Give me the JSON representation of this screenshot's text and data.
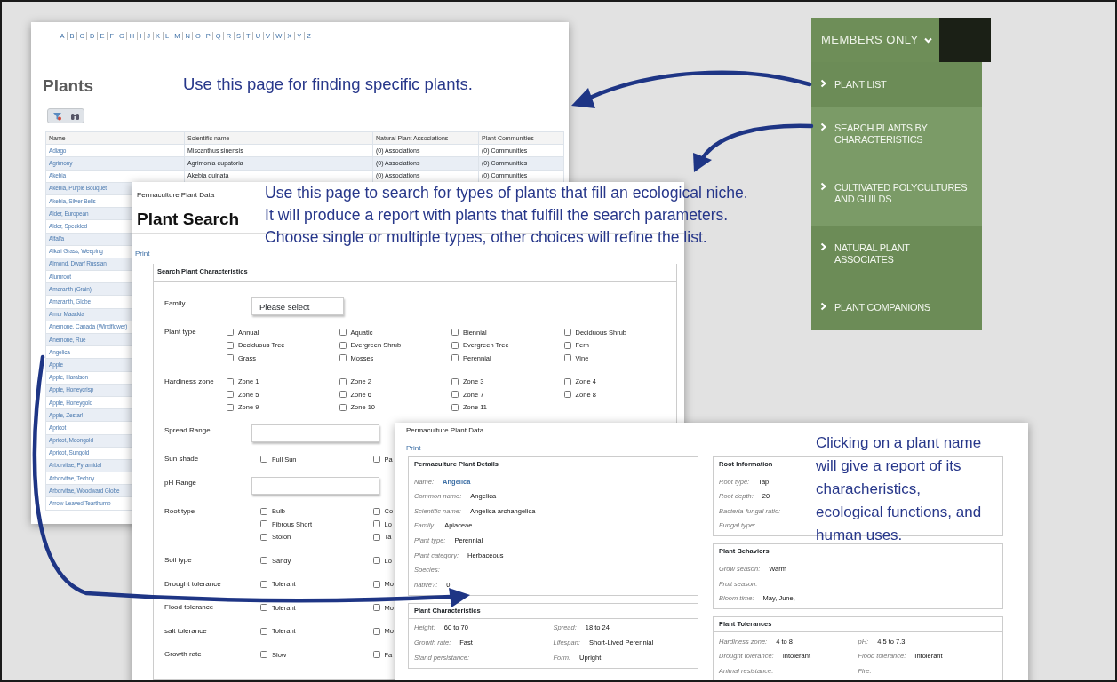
{
  "plants_page": {
    "alphabet": [
      "A",
      "B",
      "C",
      "D",
      "E",
      "F",
      "G",
      "H",
      "I",
      "J",
      "K",
      "L",
      "M",
      "N",
      "O",
      "P",
      "Q",
      "R",
      "S",
      "T",
      "U",
      "V",
      "W",
      "X",
      "Y",
      "Z"
    ],
    "title": "Plants",
    "annotation": "Use this page for finding specific plants.",
    "table": {
      "columns": [
        "Name",
        "Scientific name",
        "Natural Plant Associations",
        "Plant Communities"
      ],
      "rows": [
        {
          "cells": [
            "Adiago",
            "Miscanthus sinensis",
            "(0) Associations",
            "(0) Communities"
          ]
        },
        {
          "cells": [
            "Agrimony",
            "Agrimonia eupatoria",
            "(0) Associations",
            "(0) Communities"
          ]
        },
        {
          "cells": [
            "Akebia",
            "Akebia quinata",
            "(0) Associations",
            "(0) Communities"
          ]
        },
        {
          "cells": [
            "Akebia, Purple Bouquet"
          ]
        },
        {
          "cells": [
            "Akebia, Silver Bells"
          ]
        },
        {
          "cells": [
            "Alder, European"
          ]
        },
        {
          "cells": [
            "Alder, Speckled"
          ]
        },
        {
          "cells": [
            "Alfalfa"
          ]
        },
        {
          "cells": [
            "Alkali Grass, Weeping"
          ]
        },
        {
          "cells": [
            "Almond, Dwarf Russian"
          ]
        },
        {
          "cells": [
            "Alumroot"
          ]
        },
        {
          "cells": [
            "Amaranth (Grain)"
          ]
        },
        {
          "cells": [
            "Amaranth, Globe"
          ]
        },
        {
          "cells": [
            "Amur Maackia"
          ]
        },
        {
          "cells": [
            "Anemone, Canada (Windflower)"
          ]
        },
        {
          "cells": [
            "Anemone, Rue"
          ]
        },
        {
          "cells": [
            "Angelica"
          ]
        },
        {
          "cells": [
            "Apple"
          ]
        },
        {
          "cells": [
            "Apple, Haralson"
          ]
        },
        {
          "cells": [
            "Apple, Honeycrisp"
          ]
        },
        {
          "cells": [
            "Apple, Honeygold"
          ]
        },
        {
          "cells": [
            "Apple, Zestar!"
          ]
        },
        {
          "cells": [
            "Apricot"
          ]
        },
        {
          "cells": [
            "Apricot, Moongold"
          ]
        },
        {
          "cells": [
            "Apricot, Sungold"
          ]
        },
        {
          "cells": [
            "Arborvitae, Pyramidal"
          ]
        },
        {
          "cells": [
            "Arborvitae, Techny"
          ]
        },
        {
          "cells": [
            "Arborvitae, Woodward Globe"
          ]
        },
        {
          "cells": [
            "Arrow-Leaved Tearthumb"
          ]
        }
      ]
    }
  },
  "search_page": {
    "site": "Permaculture Plant Data",
    "title": "Plant Search",
    "print": "Print",
    "annotation": [
      "Use this page to search for types of plants that fill an ecological niche.",
      "It will produce a report with plants that fulfill the search parameters.",
      "Choose single or multiple types, other choices will refine the list."
    ],
    "section": "Search Plant Characteristics",
    "fields": [
      {
        "label": "Family",
        "kind": "select",
        "value": "Please select"
      },
      {
        "label": "Plant type",
        "kind": "checkboxes",
        "columns": [
          [
            {
              "label": "Annual",
              "checked": false
            },
            {
              "label": "Deciduous Tree",
              "checked": false
            },
            {
              "label": "Grass",
              "checked": false
            }
          ],
          [
            {
              "label": "Aquatic",
              "checked": false
            },
            {
              "label": "Evergreen Shrub",
              "checked": false
            },
            {
              "label": "Mosses",
              "checked": false
            }
          ],
          [
            {
              "label": "Biennial",
              "checked": false
            },
            {
              "label": "Evergreen Tree",
              "checked": false
            },
            {
              "label": "Perennial",
              "checked": false
            }
          ],
          [
            {
              "label": "Deciduous Shrub",
              "checked": false
            },
            {
              "label": "Fern",
              "checked": false
            },
            {
              "label": "Vine",
              "checked": false
            }
          ]
        ]
      },
      {
        "label": "Hardiness zone",
        "kind": "checkboxes",
        "columns": [
          [
            {
              "label": "Zone 1",
              "checked": false
            },
            {
              "label": "Zone 5",
              "checked": false
            },
            {
              "label": "Zone 9",
              "checked": false
            }
          ],
          [
            {
              "label": "Zone 2",
              "checked": false
            },
            {
              "label": "Zone 6",
              "checked": false
            },
            {
              "label": "Zone 10",
              "checked": false
            }
          ],
          [
            {
              "label": "Zone 3",
              "checked": false
            },
            {
              "label": "Zone 7",
              "checked": false
            },
            {
              "label": "Zone 11",
              "checked": false
            }
          ],
          [
            {
              "label": "Zone 4",
              "checked": false
            },
            {
              "label": "Zone 8",
              "checked": false
            }
          ]
        ]
      },
      {
        "label": "Spread Range",
        "kind": "text"
      },
      {
        "label": "Sun shade",
        "kind": "checkboxes",
        "columns": [
          [
            {
              "label": "Full Sun",
              "checked": false
            }
          ],
          [
            {
              "label": "Pa",
              "checked": false
            }
          ]
        ]
      },
      {
        "label": "pH Range",
        "kind": "text"
      },
      {
        "label": "Root type",
        "kind": "checkboxes",
        "columns": [
          [
            {
              "label": "Bulb",
              "checked": false
            },
            {
              "label": "Fibrous Short",
              "checked": false
            },
            {
              "label": "Stolon",
              "checked": false
            }
          ],
          [
            {
              "label": "Co",
              "checked": false
            },
            {
              "label": "Lo",
              "checked": false
            },
            {
              "label": "Ta",
              "checked": false
            }
          ]
        ]
      },
      {
        "label": "Soil type",
        "kind": "checkboxes",
        "columns": [
          [
            {
              "label": "Sandy",
              "checked": false
            }
          ],
          [
            {
              "label": "Lo",
              "checked": false
            }
          ]
        ]
      },
      {
        "label": "Drought tolerance",
        "kind": "checkboxes",
        "columns": [
          [
            {
              "label": "Tolerant",
              "checked": false
            }
          ],
          [
            {
              "label": "Mo",
              "checked": false
            }
          ]
        ]
      },
      {
        "label": "Flood tolerance",
        "kind": "checkboxes",
        "columns": [
          [
            {
              "label": "Tolerant",
              "checked": false
            }
          ],
          [
            {
              "label": "Mo",
              "checked": false
            }
          ]
        ]
      },
      {
        "label": "salt tolerance",
        "kind": "checkboxes",
        "columns": [
          [
            {
              "label": "Tolerant",
              "checked": false
            }
          ],
          [
            {
              "label": "Mo",
              "checked": false
            }
          ]
        ]
      },
      {
        "label": "Growth rate",
        "kind": "checkboxes",
        "columns": [
          [
            {
              "label": "Slow",
              "checked": false
            }
          ],
          [
            {
              "label": "Fa",
              "checked": false
            }
          ]
        ]
      }
    ]
  },
  "details_page": {
    "site": "Permaculture Plant Data",
    "print": "Print",
    "annotation": "Clicking on a plant name will give a report of its characheristics, ecological functions, and human uses.",
    "left_sections": [
      {
        "title": "Permaculture Plant Details",
        "rows": [
          [
            {
              "label": "Name:",
              "value": "Angelica",
              "kind": "link"
            }
          ],
          [
            {
              "label": "Common name:",
              "value": "Angelica",
              "kind": "text"
            }
          ],
          [
            {
              "label": "Scientific name:",
              "value": "Angelica archangelica",
              "kind": "text"
            }
          ],
          [
            {
              "label": "Family:",
              "value": "Apiaceae",
              "kind": "text"
            }
          ],
          [
            {
              "label": "Plant type:",
              "value": "Perennial",
              "kind": "text"
            }
          ],
          [
            {
              "label": "Plant category:",
              "value": "Herbaceous",
              "kind": "text"
            }
          ],
          [
            {
              "label": "Species:"
            }
          ],
          [
            {
              "label": "native?:",
              "value": "0",
              "kind": "text"
            }
          ]
        ]
      },
      {
        "title": "Plant Characteristics",
        "rows": [
          [
            {
              "label": "Height:",
              "value": "60 to 70",
              "kind": "text"
            },
            {
              "label": "Spread:",
              "value": "18 to 24",
              "kind": "text"
            }
          ],
          [
            {
              "label": "Growth rate:",
              "value": "Fast",
              "kind": "text"
            },
            {
              "label": "Lifespan:",
              "value": "Short-Lived Perennial",
              "kind": "text"
            }
          ],
          [
            {
              "label": "Stand persistance:"
            },
            {
              "label": "Form:",
              "value": "Upright",
              "kind": "text"
            }
          ]
        ]
      }
    ],
    "right_sections": [
      {
        "title": "Root Information",
        "rows": [
          [
            {
              "label": "Root type:",
              "value": "Tap",
              "kind": "text"
            }
          ],
          [
            {
              "label": "Root depth:",
              "value": "20",
              "kind": "text"
            }
          ],
          [
            {
              "label": "Bacteria-fungal ratio:"
            }
          ],
          [
            {
              "label": "Fungal type:"
            }
          ]
        ]
      },
      {
        "title": "Plant Behaviors",
        "rows": [
          [
            {
              "label": "Grow season:",
              "value": "Warm",
              "kind": "text"
            }
          ],
          [
            {
              "label": "Fruit season:"
            }
          ],
          [
            {
              "label": "Bloom time:",
              "value": "May, June,",
              "kind": "text"
            }
          ]
        ]
      },
      {
        "title": "Plant Tolerances",
        "rows": [
          [
            {
              "label": "Hardiness zone:",
              "value": "4 to 8",
              "kind": "text"
            },
            {
              "label": "pH:",
              "value": "4.5 to 7.3",
              "kind": "text"
            }
          ],
          [
            {
              "label": "Drought tolerance:",
              "value": "Intolerant",
              "kind": "text"
            },
            {
              "label": "Flood tolerance:",
              "value": "Intolerant",
              "kind": "text"
            }
          ],
          [
            {
              "label": "Animal resistance:"
            },
            {
              "label": "Fire:"
            }
          ]
        ]
      }
    ]
  },
  "menu": {
    "title": "MEMBERS ONLY",
    "items": [
      {
        "label": "PLANT LIST",
        "highlighted": false
      },
      {
        "label": "SEARCH PLANTS BY CHARACTERISTICS",
        "highlighted": true
      },
      {
        "label": "CULTIVATED POLYCULTURES AND GUILDS",
        "highlighted": true
      },
      {
        "label": "NATURAL PLANT ASSOCIATES",
        "highlighted": false
      },
      {
        "label": "PLANT COMPANIONS",
        "highlighted": false
      }
    ]
  }
}
